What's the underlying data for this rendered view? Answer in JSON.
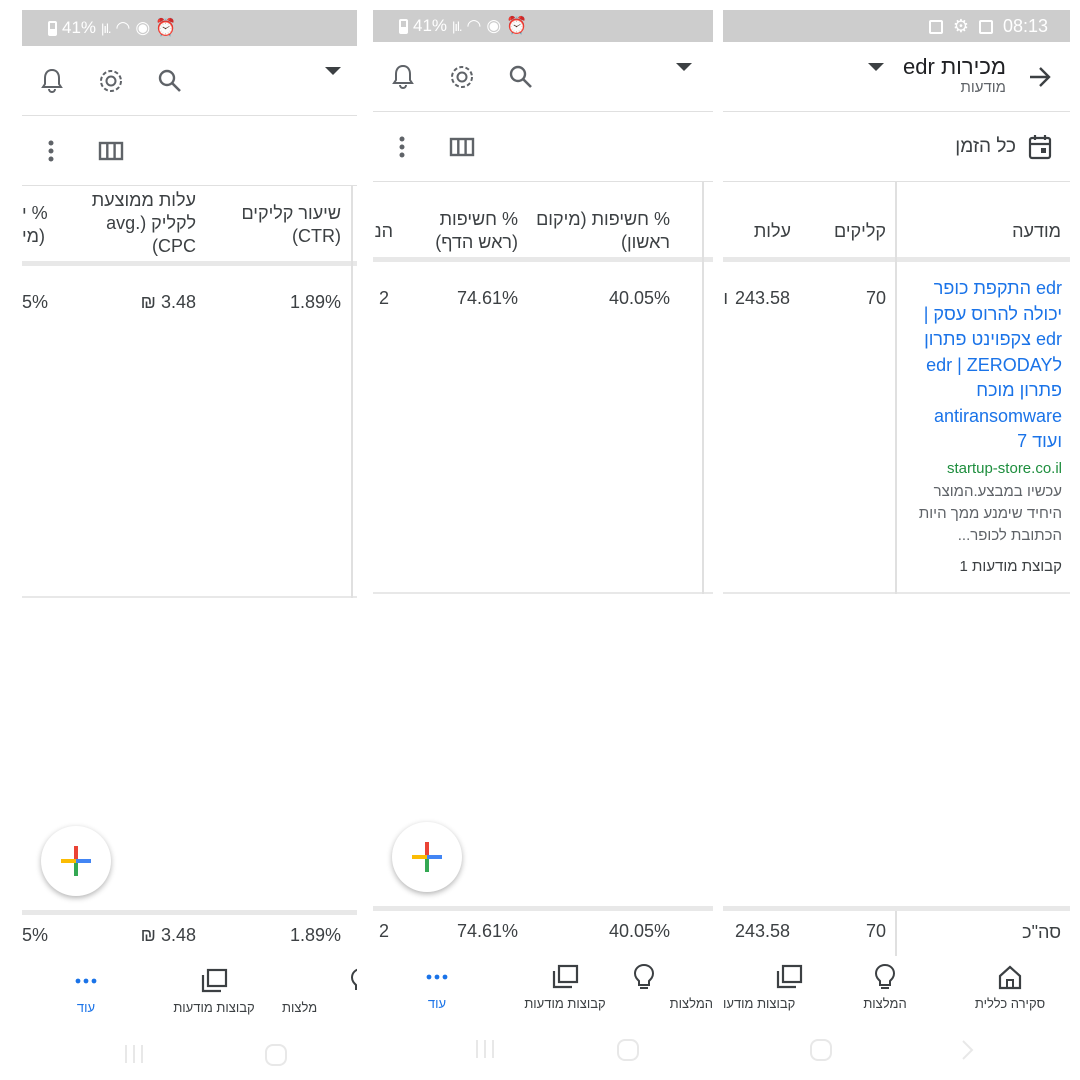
{
  "status": {
    "battery": "41%",
    "time": "08:13"
  },
  "header": {
    "title": "מכירות edr",
    "subtitle": "מודעות",
    "date_range": "כל הזמן"
  },
  "columns": {
    "ad": "מודעה",
    "clicks": "קליקים",
    "cost": "עלות",
    "impr_abs_top": "% חשיפות (מיקום ראשון)",
    "impr_top": "% חשיפות (ראש הדף)",
    "ctr_line1": "שיעור קליקים",
    "ctr_line2": "(CTR)",
    "cpc_line1": "עלות ממוצעת",
    "cpc_line2": "לקליק (.avg",
    "cpc_line3": "CPC)",
    "partial_p1": "% י",
    "partial_p1_b": "(מי",
    "partial_p2": "הנ"
  },
  "row": {
    "ad_title": "edr התקפת כופר יכולה להרוס עסק | edr צקפוינט פתרון לedr | ZERODAY פתרון מוכח antiransomware ועוד 7",
    "ad_url": "startup-store.co.il",
    "ad_desc": "עכשיו במבצע.המוצר היחיד שימנע ממך היות הכתובת לכופר...",
    "ad_group": "קבוצת מודעות 1",
    "clicks": "70",
    "cost": "243.58",
    "cost_suffix": "ו",
    "impr_abs_top": "40.05%",
    "impr_top": "74.61%",
    "partial_p2": "2",
    "ctr": "1.89%",
    "cpc": "₪ 3.48",
    "partial_p1": "5%"
  },
  "totals": {
    "label": "סה\"כ",
    "clicks": "70",
    "cost": "243.58",
    "impr_abs_top": "40.05%",
    "impr_top": "74.61%",
    "partial_p2": "2",
    "ctr": "1.89%",
    "cpc": "₪ 3.48",
    "partial_p1": "5%"
  },
  "nav": {
    "overview": "סקירה כללית",
    "recommendations": "המלצות",
    "recommendations_partial": "מלצות",
    "ad_groups": "קבוצות מודעות",
    "ad_groups_partial": "קבוצות מודעו",
    "more": "עוד"
  },
  "colors": {
    "link": "#1a73e8",
    "url": "#1e8e3e",
    "status_bar": "#cdcdcd"
  }
}
